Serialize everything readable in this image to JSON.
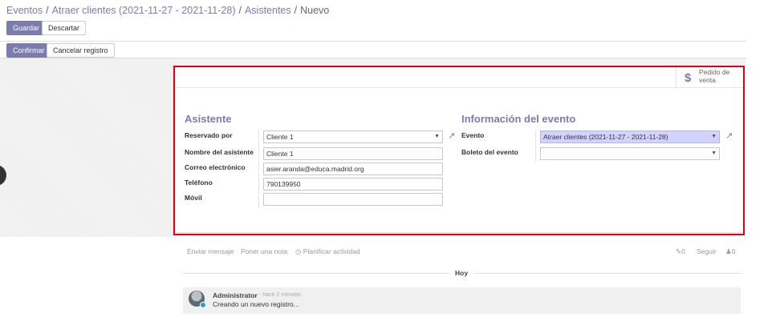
{
  "breadcrumb": [
    "Eventos",
    "Atraer clientes (2021-11-27 - 2021-11-28)",
    "Asistentes",
    "Nuevo"
  ],
  "toolbar": {
    "save": "Guardar",
    "discard": "Descartar"
  },
  "status_bar": {
    "confirm": "Confirmar",
    "cancel": "Cancelar registro"
  },
  "stat_button": {
    "line1": "Pedido de",
    "line2": "venta",
    "icon": "dollar-icon"
  },
  "attendee": {
    "title": "Asistente",
    "reserved_by_label": "Reservado por",
    "reserved_by_value": "Cliente 1",
    "name_label": "Nombre del asistente",
    "name_value": "Cliente 1",
    "email_label": "Correo electrónico",
    "email_value": "asier.aranda@educa.madrid.org",
    "phone_label": "Teléfono",
    "phone_value": "790139950",
    "mobile_label": "Móvil",
    "mobile_value": ""
  },
  "event_info": {
    "title": "Información del evento",
    "event_label": "Evento",
    "event_value": "Atraer clientes (2021-11-27 - 2021-11-28)",
    "ticket_label": "Boleto del evento",
    "ticket_value": ""
  },
  "chatter": {
    "send_message": "Enviar mensaje",
    "log_note": "Poner una nota",
    "schedule_activity": "Planificar actividad",
    "attachments": "0",
    "follow": "Seguir",
    "followers": "0",
    "today": "Hoy",
    "message": {
      "author": "Administrator",
      "time": "- hace 2 minutos",
      "body": "Creando un nuevo registro..."
    }
  },
  "colors": {
    "accent": "#7c7bad",
    "highlight": "#e3001b"
  }
}
